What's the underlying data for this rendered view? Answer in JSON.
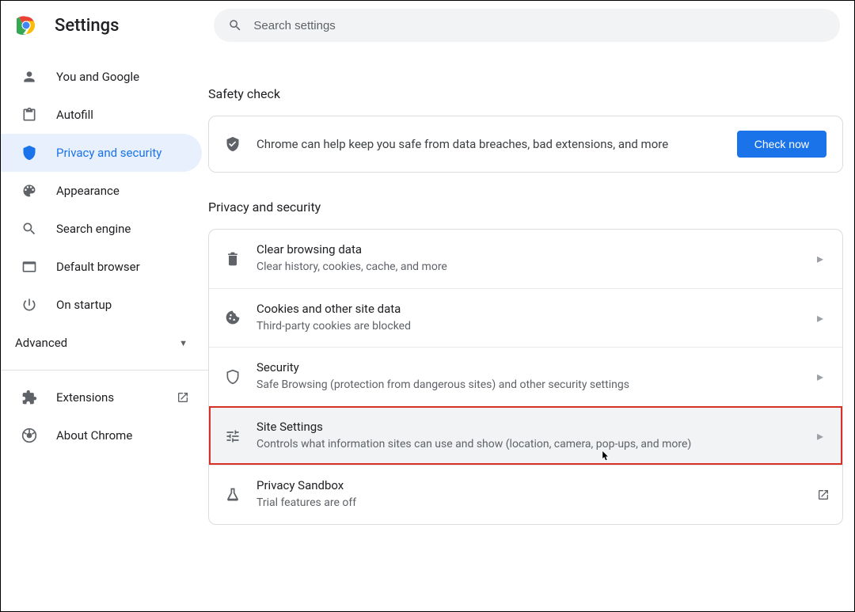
{
  "header": {
    "title": "Settings",
    "search_placeholder": "Search settings"
  },
  "sidebar": {
    "items": [
      {
        "icon": "person-icon",
        "label": "You and Google"
      },
      {
        "icon": "clipboard-icon",
        "label": "Autofill"
      },
      {
        "icon": "shield-icon",
        "label": "Privacy and security",
        "active": true
      },
      {
        "icon": "palette-icon",
        "label": "Appearance"
      },
      {
        "icon": "search-icon",
        "label": "Search engine"
      },
      {
        "icon": "browser-icon",
        "label": "Default browser"
      },
      {
        "icon": "power-icon",
        "label": "On startup"
      }
    ],
    "advanced_label": "Advanced",
    "footer": [
      {
        "icon": "extension-icon",
        "label": "Extensions",
        "external": true
      },
      {
        "icon": "chrome-icon",
        "label": "About Chrome"
      }
    ]
  },
  "content": {
    "safety_check": {
      "title": "Safety check",
      "desc": "Chrome can help keep you safe from data breaches, bad extensions, and more",
      "button": "Check now"
    },
    "privacy": {
      "title": "Privacy and security",
      "items": [
        {
          "icon": "trash-icon",
          "title": "Clear browsing data",
          "desc": "Clear history, cookies, cache, and more",
          "arrow": "chevron"
        },
        {
          "icon": "cookie-icon",
          "title": "Cookies and other site data",
          "desc": "Third-party cookies are blocked",
          "arrow": "chevron"
        },
        {
          "icon": "shield-outline-icon",
          "title": "Security",
          "desc": "Safe Browsing (protection from dangerous sites) and other security settings",
          "arrow": "chevron"
        },
        {
          "icon": "tune-icon",
          "title": "Site Settings",
          "desc": "Controls what information sites can use and show (location, camera, pop-ups, and more)",
          "arrow": "chevron",
          "highlighted": true
        },
        {
          "icon": "flask-icon",
          "title": "Privacy Sandbox",
          "desc": "Trial features are off",
          "arrow": "external"
        }
      ]
    }
  }
}
